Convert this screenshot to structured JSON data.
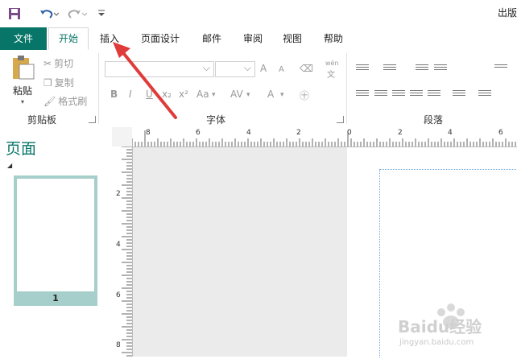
{
  "title": "出版",
  "quick_access": {
    "save_icon": "save-icon",
    "undo_icon": "undo-icon",
    "redo_icon": "redo-icon",
    "customize_icon": "chevron-down-icon"
  },
  "tabs": [
    {
      "label": "文件"
    },
    {
      "label": "开始"
    },
    {
      "label": "插入"
    },
    {
      "label": "页面设计"
    },
    {
      "label": "邮件"
    },
    {
      "label": "审阅"
    },
    {
      "label": "视图"
    },
    {
      "label": "帮助"
    }
  ],
  "clipboard": {
    "paste": "粘贴",
    "cut": "剪切",
    "copy": "复制",
    "format_painter": "格式刷",
    "group_label": "剪贴板"
  },
  "font": {
    "group_label": "字体",
    "bold": "B",
    "italic": "I",
    "underline": "U",
    "subscript": "x₂",
    "superscript": "x²",
    "case": "Aa",
    "spacing": "AV",
    "color": "A",
    "grow": "A",
    "shrink": "A",
    "phonetic_top": "wén",
    "phonetic_bottom": "文"
  },
  "paragraph": {
    "group_label": "段落"
  },
  "pages_panel": {
    "title": "页面",
    "thumb_number": "1"
  },
  "hruler_labels": [
    "8",
    "6",
    "4",
    "2",
    "0",
    "2",
    "4",
    "6"
  ],
  "vruler_labels": [
    "2",
    "4",
    "6",
    "8"
  ],
  "watermark": {
    "brand": "Baidu经验",
    "url": "jingyan.baidu.com"
  },
  "colors": {
    "accent": "#077568",
    "arrow": "#e03b3b"
  }
}
